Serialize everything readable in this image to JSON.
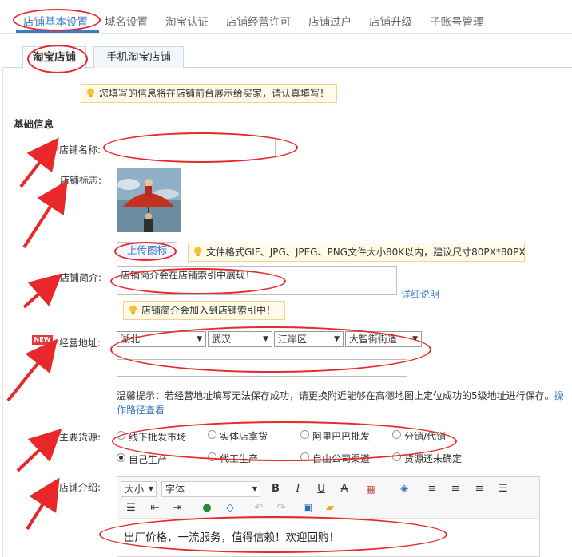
{
  "topnav": {
    "items": [
      "店铺基本设置",
      "域名设置",
      "淘宝认证",
      "店铺经营许可",
      "店铺过户",
      "店铺升级",
      "子账号管理"
    ]
  },
  "tabs": [
    "淘宝店铺",
    "手机淘宝店铺"
  ],
  "notice": "您填写的信息将在店铺前台展示给买家，请认真填写！",
  "section_title": "基础信息",
  "form": {
    "required_mark": "*",
    "shop_name": {
      "label": "店铺名称:",
      "value": ""
    },
    "shop_logo": {
      "label": "店铺标志:",
      "upload_label": "上传图标",
      "tip": "文件格式GIF、JPG、JPEG、PNG文件大小80K以内，建议尺寸80PX*80PX"
    },
    "shop_intro": {
      "label": "店铺简介:",
      "value": "店铺简介会在店铺索引中展现！",
      "detail_link": "详细说明",
      "tip": "店铺简介会加入到店铺索引中！"
    },
    "address": {
      "label": "经营地址:",
      "badge": "NEW",
      "province": "湖北",
      "city": "武汉",
      "district": "江岸区",
      "street": "大智街街道",
      "detail": "",
      "hint": "温馨提示：若经营地址填写无法保存成功，请更换附近能够在高德地图上定位成功的5级地址进行保存。",
      "hint_link_1": "操",
      "hint_link_2": "作路径查看"
    },
    "source": {
      "label": "主要货源:",
      "options": [
        "线下批发市场",
        "实体店拿货",
        "阿里巴巴批发",
        "分销/代销",
        "自己生产",
        "代工生产",
        "自由公司渠道",
        "货源还未确定"
      ],
      "selected": "自己生产"
    },
    "intro": {
      "label": "店铺介绍:",
      "font_size": "大小",
      "font_family": "字体",
      "content": "出厂价格，一流服务，值得信赖！欢迎回购！"
    }
  },
  "colors": {
    "accent": "#3e7bc2",
    "required": "#e4393c",
    "annotation": "#e8282b"
  }
}
